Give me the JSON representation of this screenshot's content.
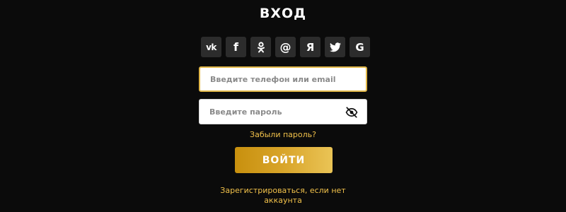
{
  "title": "ВХОД",
  "social": [
    {
      "icon": "vk-icon",
      "label": "vk"
    },
    {
      "icon": "facebook-icon",
      "label": "f"
    },
    {
      "icon": "odnoklassniki-icon",
      "label": ""
    },
    {
      "icon": "mail-icon",
      "label": "@"
    },
    {
      "icon": "yandex-icon",
      "label": "Я"
    },
    {
      "icon": "twitter-icon",
      "label": ""
    },
    {
      "icon": "google-icon",
      "label": "G"
    }
  ],
  "login": {
    "placeholder": "Введите телефон или email",
    "value": ""
  },
  "password": {
    "placeholder": "Введите пароль",
    "value": "",
    "toggle_icon": "eye-off-icon"
  },
  "forgot_label": "Забыли пароль?",
  "submit_label": "ВОЙТИ",
  "register_label": "Зарегистрироваться, если нет аккаунта",
  "colors": {
    "background": "#0b0b0b",
    "accent": "#f1c14a",
    "button_gradient_start": "#c8900e",
    "button_gradient_end": "#eac456",
    "social_bg": "#2c2c2c"
  }
}
